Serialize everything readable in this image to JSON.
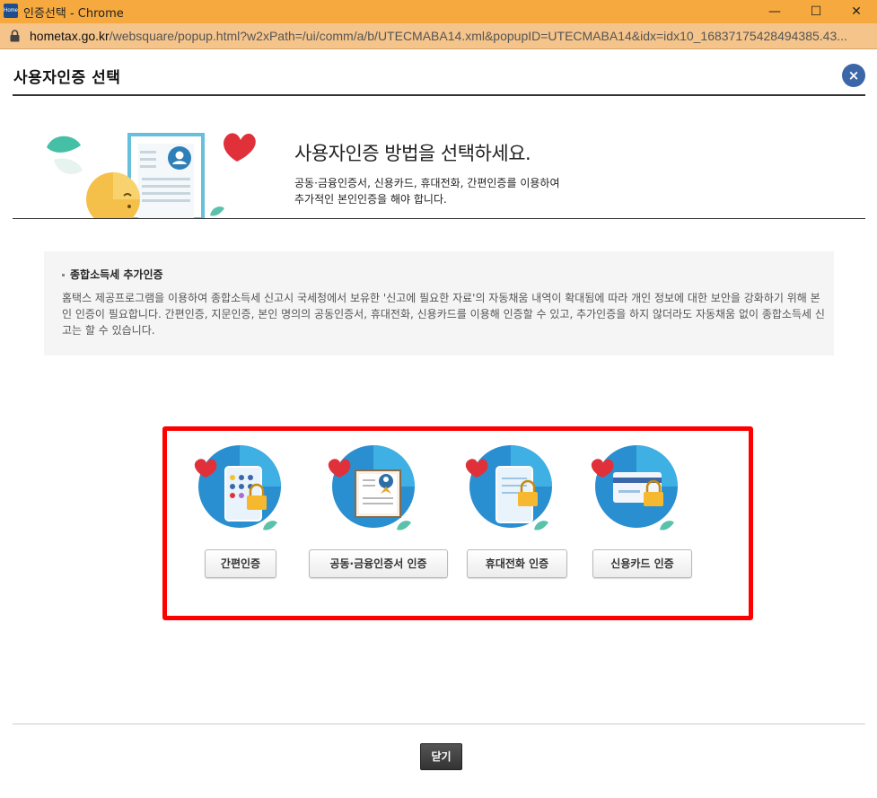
{
  "window": {
    "title": "인증선택 - Chrome",
    "app_icon_text": "Home",
    "minimize": "—",
    "maximize": "☐",
    "close": "✕"
  },
  "address_bar": {
    "host": "hometax.go.kr",
    "path": "/websquare/popup.html?w2xPath=/ui/comm/a/b/UTECMABA14.xml&popupID=UTECMABA14&idx=idx10_16837175428494385.43..."
  },
  "popup": {
    "title": "사용자인증 선택",
    "close_icon": "×"
  },
  "hero": {
    "title": "사용자인증 방법을 선택하세요.",
    "subtitle_line1": "공동·금융인증서, 신용카드, 휴대전화, 간편인증를 이용하여",
    "subtitle_line2": "추가적인 본인인증을 해야 합니다."
  },
  "info": {
    "heading": "종합소득세 추가인증",
    "body": "홈택스 제공프로그램을 이용하여 종합소득세 신고시 국세청에서 보유한 '신고에 필요한 자료'의 자동채움 내역이 확대됨에 따라 개인 정보에 대한 보안을 강화하기 위해 본인 인증이 필요합니다. 간편인증, 지문인증, 본인 명의의 공동인증서, 휴대전화, 신용카드를 이용해 인증할 수 있고, 추가인증을 하지 않더라도 자동채움 없이 종합소득세 신고는 할 수 있습니다."
  },
  "auth_methods": [
    {
      "label": "간편인증",
      "icon": "phone-app-lock-icon"
    },
    {
      "label": "공동·금융인증서 인증",
      "icon": "certificate-icon"
    },
    {
      "label": "휴대전화 인증",
      "icon": "mobile-phone-lock-icon"
    },
    {
      "label": "신용카드 인증",
      "icon": "credit-card-lock-icon"
    }
  ],
  "footer": {
    "close_label": "닫기"
  },
  "colors": {
    "titlebar": "#f6a93e",
    "highlight_frame": "#ff0000",
    "close_circle": "#3b66a8"
  }
}
